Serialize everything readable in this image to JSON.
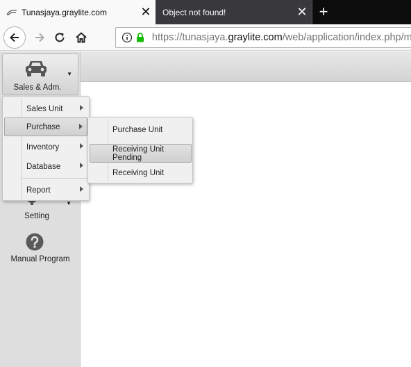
{
  "browser": {
    "tabs": [
      {
        "title": "Tunasjaya.graylite.com",
        "active": true
      },
      {
        "title": "Object not found!",
        "active": false
      }
    ],
    "url": {
      "prefix": "https://tunasjaya.",
      "domain": "graylite.com",
      "path": "/web/application/index.php/mai"
    }
  },
  "sidebar": {
    "module_button": {
      "label": "Sales & Adm.",
      "icon": "car-icon"
    },
    "setting": {
      "label": "Setting",
      "icon": "gear-icon"
    },
    "manual": {
      "label": "Manual Program",
      "icon": "help-icon"
    }
  },
  "menu": {
    "items": [
      {
        "label": "Sales Unit",
        "has_submenu": true
      },
      {
        "label": "Purchase",
        "has_submenu": true,
        "highlighted": true
      },
      {
        "label": "Inventory",
        "has_submenu": true
      },
      {
        "label": "Database",
        "has_submenu": true
      },
      {
        "label": "Report",
        "has_submenu": true
      }
    ]
  },
  "submenu": {
    "items": [
      {
        "label": "Purchase Unit"
      },
      {
        "label": "Receiving Unit Pending",
        "highlighted": true
      },
      {
        "label": "Receiving Unit"
      }
    ]
  }
}
